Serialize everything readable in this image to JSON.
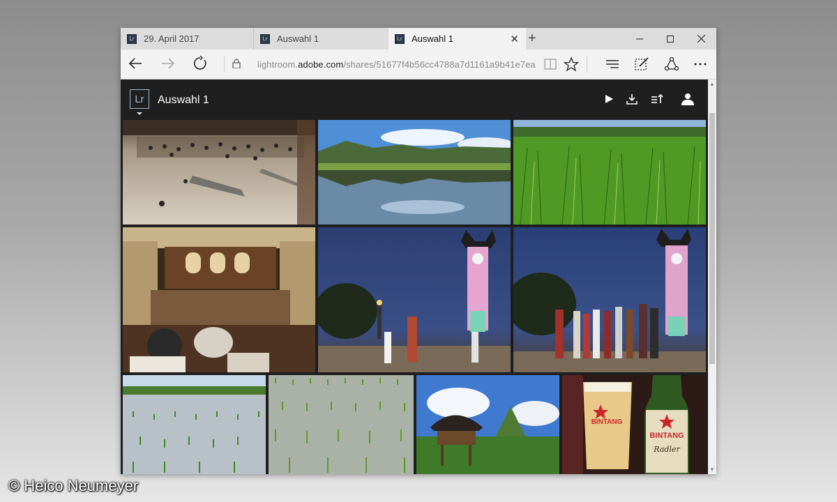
{
  "tabs": [
    {
      "label": "29. April 2017",
      "icon": "lr-icon"
    },
    {
      "label": "Auswahl 1",
      "icon": "lr-icon"
    },
    {
      "label": "Auswahl 1",
      "icon": "lr-icon",
      "active": true
    }
  ],
  "address": {
    "url_prefix": "lightroom.",
    "url_domain": "adobe.com",
    "url_path": "/shares/51677f4b56cc4788a7d1161a9b41e7ea"
  },
  "app": {
    "logo_text": "Lr",
    "title": "Auswahl 1"
  },
  "tab_icon_text": "Lr",
  "header_actions": [
    "play-icon",
    "download-icon",
    "sort-icon",
    "user-icon"
  ],
  "photos": [
    {
      "name": "photo-airport-hall"
    },
    {
      "name": "photo-lake-reflection"
    },
    {
      "name": "photo-rice-field"
    },
    {
      "name": "photo-hotel-lobby"
    },
    {
      "name": "photo-clock-tower-night-1"
    },
    {
      "name": "photo-clock-tower-night-2"
    },
    {
      "name": "photo-rice-paddy-1"
    },
    {
      "name": "photo-rice-paddy-2"
    },
    {
      "name": "photo-traditional-house"
    },
    {
      "name": "photo-bintang-beer"
    }
  ],
  "credit": "© Heico Neumeyer",
  "colors": {
    "accent_lr": "#9fbad1",
    "app_bg": "#1f1f1f"
  }
}
